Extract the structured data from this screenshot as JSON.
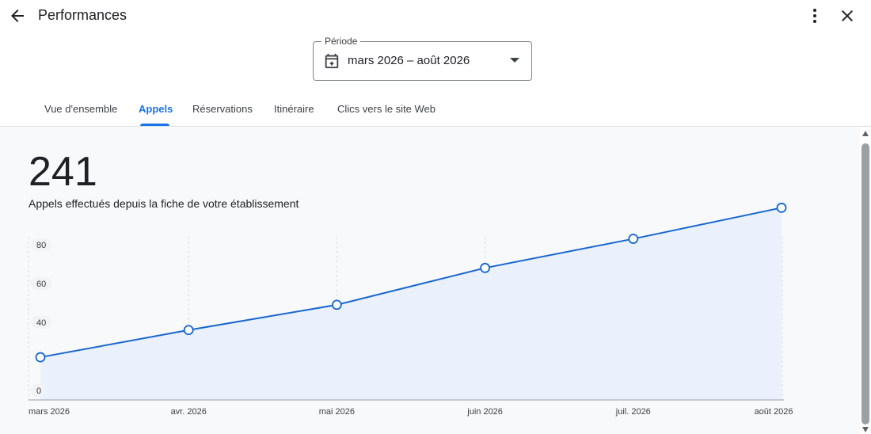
{
  "header": {
    "title": "Performances",
    "back_icon": "arrow-back-icon",
    "more_icon": "more-vert-icon",
    "close_icon": "close-icon"
  },
  "period": {
    "label": "Période",
    "value": "mars 2026 – août 2026",
    "icon": "calendar-icon"
  },
  "tabs": [
    {
      "label": "Vue d'ensemble",
      "active": false
    },
    {
      "label": "Appels",
      "active": true
    },
    {
      "label": "Réservations",
      "active": false
    },
    {
      "label": "Itinéraire",
      "active": false
    },
    {
      "label": "Clics vers le site Web",
      "active": false
    }
  ],
  "summary": {
    "total": "241",
    "description": "Appels effectués depuis la fiche de votre établissement"
  },
  "colors": {
    "accent": "#1a73e8",
    "line": "#1967d2",
    "area": "#eaf1fc"
  },
  "chart_data": {
    "type": "area",
    "categories": [
      "mars 2026",
      "avr. 2026",
      "mai 2026",
      "juin 2026",
      "juil. 2026",
      "août 2026"
    ],
    "values": [
      22,
      36,
      49,
      68,
      83,
      99
    ],
    "y_ticks": [
      0,
      40,
      60,
      80
    ],
    "y_tick_labels": [
      "0",
      "40",
      "60",
      "80"
    ],
    "ylim": [
      0,
      100
    ],
    "grid": "vertical-dashed"
  }
}
